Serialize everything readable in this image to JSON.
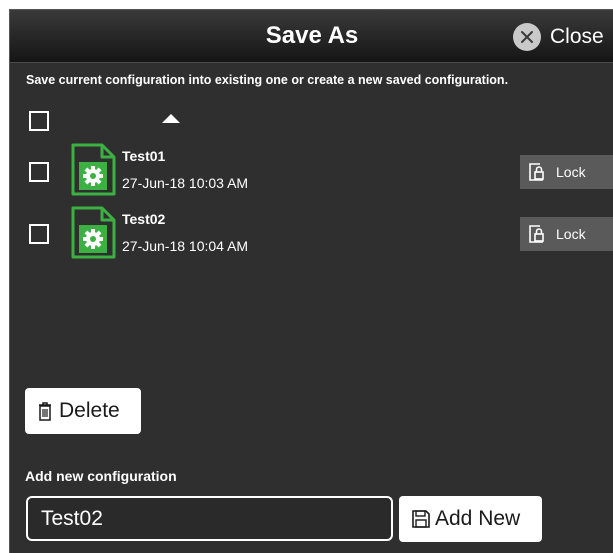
{
  "dialog": {
    "title": "Save As",
    "close_label": "Close",
    "instruction": "Save current configuration into existing one or create a new saved configuration."
  },
  "list": {
    "items": [
      {
        "name": "Test01",
        "date": "27-Jun-18 10:03 AM",
        "lock_label": "Lock",
        "checked": false,
        "icon": "config-file-icon"
      },
      {
        "name": "Test02",
        "date": "27-Jun-18 10:04 AM",
        "lock_label": "Lock",
        "checked": false,
        "icon": "config-file-icon"
      }
    ]
  },
  "actions": {
    "delete_label": "Delete",
    "add_new_title": "Add new configuration",
    "input_value": "Test02",
    "add_new_label": "Add New"
  },
  "colors": {
    "background": "#2f2f2f",
    "icon_green": "#3cb043",
    "button_gray": "#5a5a5a"
  }
}
